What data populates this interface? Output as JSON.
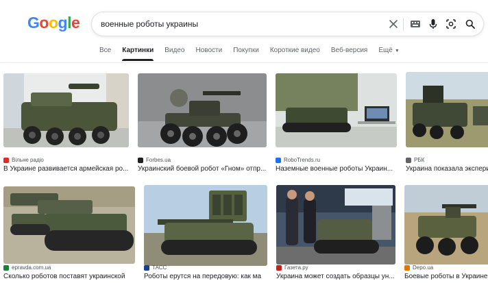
{
  "logo": {
    "letters": [
      "G",
      "o",
      "o",
      "g",
      "l",
      "e"
    ],
    "colors": [
      "#4285f4",
      "#ea4335",
      "#fbbc05",
      "#4285f4",
      "#34a853",
      "#ea4335"
    ]
  },
  "search": {
    "query": "военные роботы украины",
    "icons": [
      "close-icon",
      "keyboard-icon",
      "mic-icon",
      "lens-icon",
      "search-icon"
    ]
  },
  "tabs": [
    {
      "label": "Все",
      "active": false
    },
    {
      "label": "Картинки",
      "active": true
    },
    {
      "label": "Видео",
      "active": false
    },
    {
      "label": "Новости",
      "active": false
    },
    {
      "label": "Покупки",
      "active": false
    },
    {
      "label": "Короткие видео",
      "active": false
    },
    {
      "label": "Веб-версия",
      "active": false
    },
    {
      "label": "Ещё",
      "active": false
    }
  ],
  "results": [
    {
      "source": "Вільне радіо",
      "title": "В Украине развивается армейская ро...",
      "favicon_color": "#d93025"
    },
    {
      "source": "Forbes.ua",
      "title": "Украинский боевой робот «Гном» отпр...",
      "favicon_color": "#202124"
    },
    {
      "source": "RoboTrends.ru",
      "title": "Наземные военные роботы Украин...",
      "favicon_color": "#1a73e8"
    },
    {
      "source": "РБК",
      "title": "Украина показала экспери",
      "favicon_color": "#5f6368"
    },
    {
      "source": "epravda.com.ua",
      "title": "Сколько роботов поставят украинской",
      "favicon_color": "#188038"
    },
    {
      "source": "ТАСС",
      "title": "Роботы ерутся на передовую: как ма",
      "favicon_color": "#1a3d8f"
    },
    {
      "source": "Газета.ру",
      "title": "Украина может создать образцы ун...",
      "favicon_color": "#c5221f"
    },
    {
      "source": "Depo.ua",
      "title": "Боевые роботы в Украине",
      "favicon_color": "#e37400"
    }
  ]
}
